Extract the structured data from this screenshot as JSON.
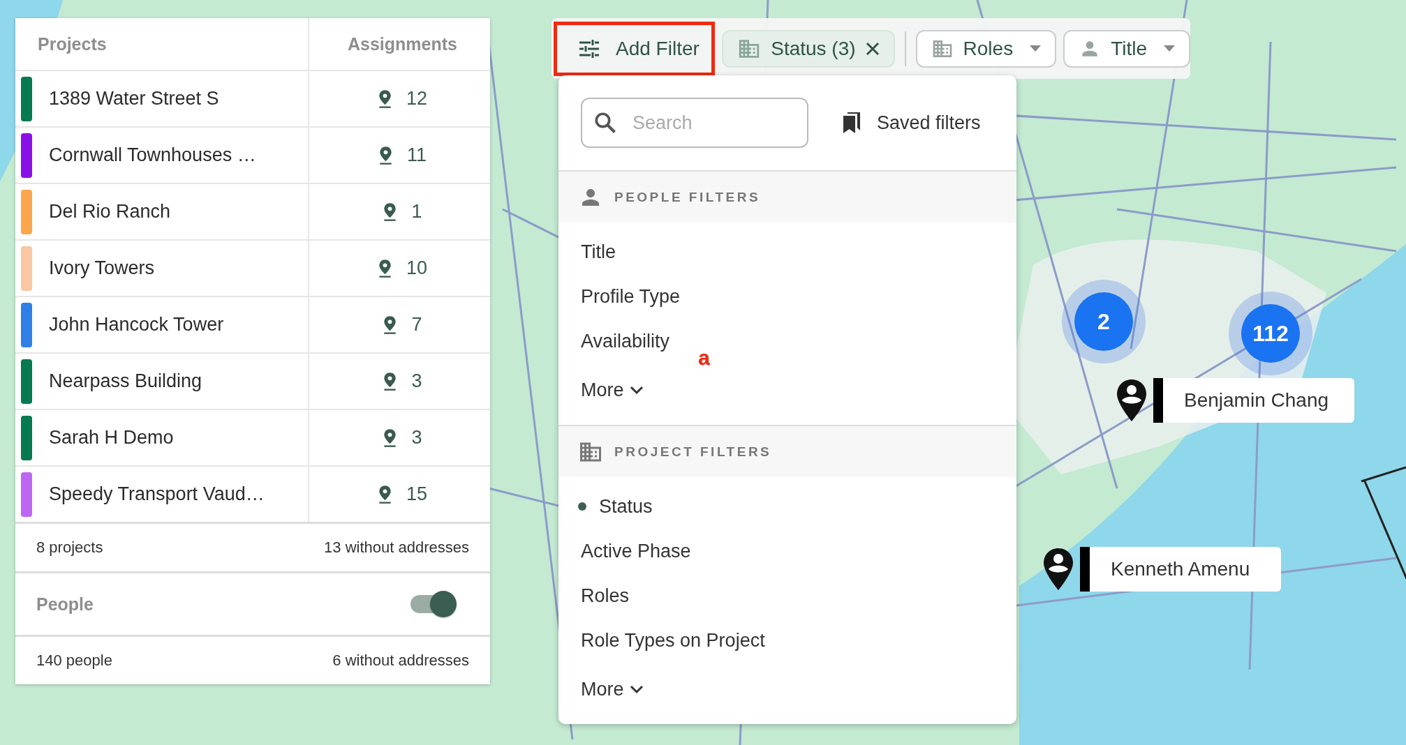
{
  "projects_panel": {
    "columns": [
      "Projects",
      "Assignments"
    ],
    "rows": [
      {
        "name": "1389 Water Street S",
        "assignments": "12",
        "color": "#067a50"
      },
      {
        "name": "Cornwall Townhouses …",
        "assignments": "11",
        "color": "#8a10e8"
      },
      {
        "name": "Del Rio Ranch",
        "assignments": "1",
        "color": "#fca54c"
      },
      {
        "name": "Ivory Towers",
        "assignments": "10",
        "color": "#fbc6a2"
      },
      {
        "name": "John Hancock Tower",
        "assignments": "7",
        "color": "#2f80e6"
      },
      {
        "name": "Nearpass Building",
        "assignments": "3",
        "color": "#067a50"
      },
      {
        "name": "Sarah H Demo",
        "assignments": "3",
        "color": "#067a50"
      },
      {
        "name": "Speedy Transport Vaud…",
        "assignments": "15",
        "color": "#be65f5"
      }
    ],
    "footer": {
      "count": "8 projects",
      "missing": "13 without addresses"
    },
    "people": {
      "label": "People",
      "on": true
    },
    "people_footer": {
      "count": "140 people",
      "missing": "6 without addresses"
    }
  },
  "filter_bar": {
    "add_filter": {
      "label": "Add Filter",
      "highlighted": true
    },
    "chips": [
      {
        "kind": "active",
        "label": "Status (3)"
      },
      {
        "kind": "dropdown",
        "label": "Roles"
      },
      {
        "kind": "dropdown",
        "label": "Title"
      }
    ]
  },
  "filter_menu": {
    "search": {
      "placeholder": "Search"
    },
    "saved_filters": "Saved filters",
    "sections": [
      {
        "title": "PEOPLE FILTERS",
        "items": [
          {
            "label": "Title",
            "active": false
          },
          {
            "label": "Profile Type",
            "active": false
          },
          {
            "label": "Availability",
            "active": false
          }
        ],
        "more": "More"
      },
      {
        "title": "PROJECT FILTERS",
        "items": [
          {
            "label": "Status",
            "active": true
          },
          {
            "label": "Active Phase",
            "active": false
          },
          {
            "label": "Roles",
            "active": false
          },
          {
            "label": "Role Types on Project",
            "active": false
          }
        ],
        "more": "More"
      }
    ]
  },
  "annotation": "a",
  "map": {
    "clusters": [
      {
        "count": "2"
      },
      {
        "count": "112"
      }
    ],
    "people": [
      {
        "name": "Benjamin Chang"
      },
      {
        "name": "Kenneth Amenu"
      }
    ]
  }
}
